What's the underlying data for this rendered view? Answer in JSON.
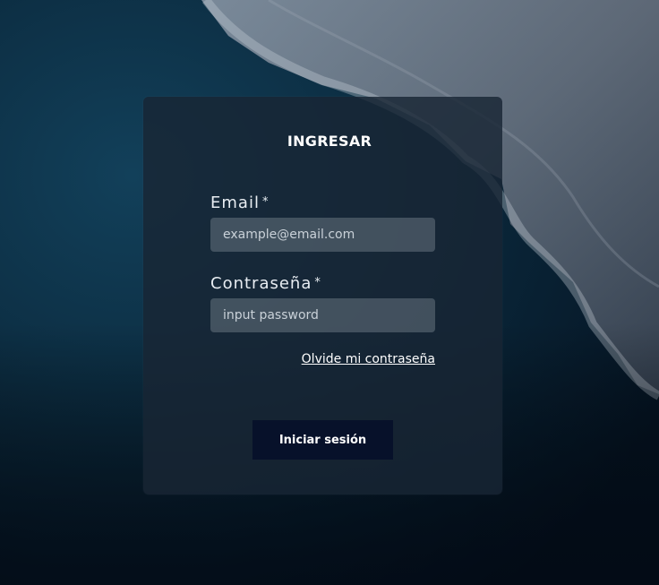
{
  "login": {
    "title": "INGRESAR",
    "email_label": "Email",
    "email_required": "*",
    "email_placeholder": "example@email.com",
    "email_value": "",
    "password_label": "Contraseña",
    "password_required": "*",
    "password_placeholder": "input password",
    "password_value": "",
    "forgot_link": "Olvide mi contraseña",
    "submit_label": "Iniciar sesión"
  },
  "colors": {
    "background_ocean": "#0c2233",
    "card": "#18263a",
    "button": "#07112a",
    "text": "#ffffff"
  }
}
